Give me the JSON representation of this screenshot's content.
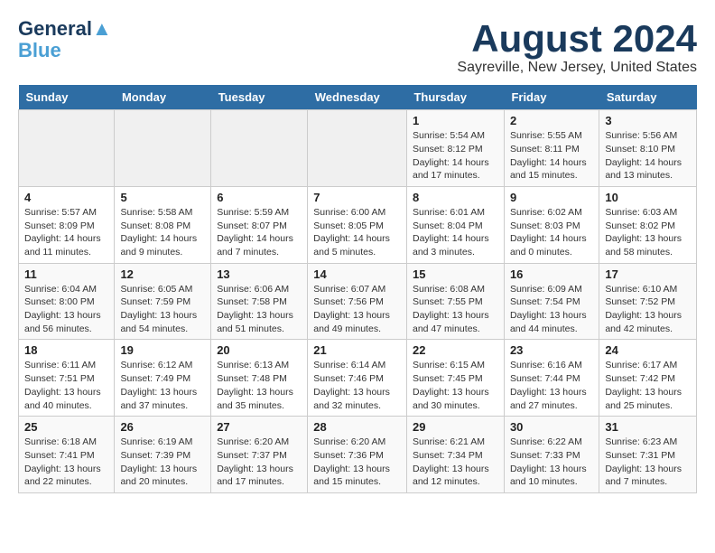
{
  "logo": {
    "line1": "General",
    "line2": "Blue"
  },
  "title": "August 2024",
  "subtitle": "Sayreville, New Jersey, United States",
  "weekdays": [
    "Sunday",
    "Monday",
    "Tuesday",
    "Wednesday",
    "Thursday",
    "Friday",
    "Saturday"
  ],
  "weeks": [
    [
      {
        "day": "",
        "info": ""
      },
      {
        "day": "",
        "info": ""
      },
      {
        "day": "",
        "info": ""
      },
      {
        "day": "",
        "info": ""
      },
      {
        "day": "1",
        "info": "Sunrise: 5:54 AM\nSunset: 8:12 PM\nDaylight: 14 hours\nand 17 minutes."
      },
      {
        "day": "2",
        "info": "Sunrise: 5:55 AM\nSunset: 8:11 PM\nDaylight: 14 hours\nand 15 minutes."
      },
      {
        "day": "3",
        "info": "Sunrise: 5:56 AM\nSunset: 8:10 PM\nDaylight: 14 hours\nand 13 minutes."
      }
    ],
    [
      {
        "day": "4",
        "info": "Sunrise: 5:57 AM\nSunset: 8:09 PM\nDaylight: 14 hours\nand 11 minutes."
      },
      {
        "day": "5",
        "info": "Sunrise: 5:58 AM\nSunset: 8:08 PM\nDaylight: 14 hours\nand 9 minutes."
      },
      {
        "day": "6",
        "info": "Sunrise: 5:59 AM\nSunset: 8:07 PM\nDaylight: 14 hours\nand 7 minutes."
      },
      {
        "day": "7",
        "info": "Sunrise: 6:00 AM\nSunset: 8:05 PM\nDaylight: 14 hours\nand 5 minutes."
      },
      {
        "day": "8",
        "info": "Sunrise: 6:01 AM\nSunset: 8:04 PM\nDaylight: 14 hours\nand 3 minutes."
      },
      {
        "day": "9",
        "info": "Sunrise: 6:02 AM\nSunset: 8:03 PM\nDaylight: 14 hours\nand 0 minutes."
      },
      {
        "day": "10",
        "info": "Sunrise: 6:03 AM\nSunset: 8:02 PM\nDaylight: 13 hours\nand 58 minutes."
      }
    ],
    [
      {
        "day": "11",
        "info": "Sunrise: 6:04 AM\nSunset: 8:00 PM\nDaylight: 13 hours\nand 56 minutes."
      },
      {
        "day": "12",
        "info": "Sunrise: 6:05 AM\nSunset: 7:59 PM\nDaylight: 13 hours\nand 54 minutes."
      },
      {
        "day": "13",
        "info": "Sunrise: 6:06 AM\nSunset: 7:58 PM\nDaylight: 13 hours\nand 51 minutes."
      },
      {
        "day": "14",
        "info": "Sunrise: 6:07 AM\nSunset: 7:56 PM\nDaylight: 13 hours\nand 49 minutes."
      },
      {
        "day": "15",
        "info": "Sunrise: 6:08 AM\nSunset: 7:55 PM\nDaylight: 13 hours\nand 47 minutes."
      },
      {
        "day": "16",
        "info": "Sunrise: 6:09 AM\nSunset: 7:54 PM\nDaylight: 13 hours\nand 44 minutes."
      },
      {
        "day": "17",
        "info": "Sunrise: 6:10 AM\nSunset: 7:52 PM\nDaylight: 13 hours\nand 42 minutes."
      }
    ],
    [
      {
        "day": "18",
        "info": "Sunrise: 6:11 AM\nSunset: 7:51 PM\nDaylight: 13 hours\nand 40 minutes."
      },
      {
        "day": "19",
        "info": "Sunrise: 6:12 AM\nSunset: 7:49 PM\nDaylight: 13 hours\nand 37 minutes."
      },
      {
        "day": "20",
        "info": "Sunrise: 6:13 AM\nSunset: 7:48 PM\nDaylight: 13 hours\nand 35 minutes."
      },
      {
        "day": "21",
        "info": "Sunrise: 6:14 AM\nSunset: 7:46 PM\nDaylight: 13 hours\nand 32 minutes."
      },
      {
        "day": "22",
        "info": "Sunrise: 6:15 AM\nSunset: 7:45 PM\nDaylight: 13 hours\nand 30 minutes."
      },
      {
        "day": "23",
        "info": "Sunrise: 6:16 AM\nSunset: 7:44 PM\nDaylight: 13 hours\nand 27 minutes."
      },
      {
        "day": "24",
        "info": "Sunrise: 6:17 AM\nSunset: 7:42 PM\nDaylight: 13 hours\nand 25 minutes."
      }
    ],
    [
      {
        "day": "25",
        "info": "Sunrise: 6:18 AM\nSunset: 7:41 PM\nDaylight: 13 hours\nand 22 minutes."
      },
      {
        "day": "26",
        "info": "Sunrise: 6:19 AM\nSunset: 7:39 PM\nDaylight: 13 hours\nand 20 minutes."
      },
      {
        "day": "27",
        "info": "Sunrise: 6:20 AM\nSunset: 7:37 PM\nDaylight: 13 hours\nand 17 minutes."
      },
      {
        "day": "28",
        "info": "Sunrise: 6:20 AM\nSunset: 7:36 PM\nDaylight: 13 hours\nand 15 minutes."
      },
      {
        "day": "29",
        "info": "Sunrise: 6:21 AM\nSunset: 7:34 PM\nDaylight: 13 hours\nand 12 minutes."
      },
      {
        "day": "30",
        "info": "Sunrise: 6:22 AM\nSunset: 7:33 PM\nDaylight: 13 hours\nand 10 minutes."
      },
      {
        "day": "31",
        "info": "Sunrise: 6:23 AM\nSunset: 7:31 PM\nDaylight: 13 hours\nand 7 minutes."
      }
    ]
  ]
}
